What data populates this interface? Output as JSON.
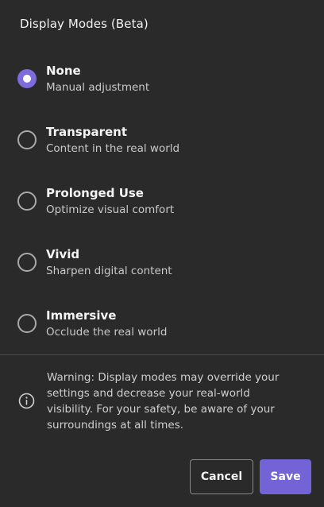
{
  "dialog": {
    "title": "Display Modes (Beta)"
  },
  "options": [
    {
      "label": "None",
      "description": "Manual adjustment",
      "selected": true
    },
    {
      "label": "Transparent",
      "description": "Content in the real world",
      "selected": false
    },
    {
      "label": "Prolonged Use",
      "description": "Optimize visual comfort",
      "selected": false
    },
    {
      "label": "Vivid",
      "description": "Sharpen digital content",
      "selected": false
    },
    {
      "label": "Immersive",
      "description": "Occlude the real world",
      "selected": false
    }
  ],
  "warning": {
    "icon": "info-icon",
    "text": "Warning: Display modes may override your settings and decrease your real-world visibility. For your safety, be aware of your surroundings at all times."
  },
  "buttons": {
    "cancel_label": "Cancel",
    "save_label": "Save"
  },
  "colors": {
    "background": "#2a2a2b",
    "accent": "#7463d6",
    "radio_selected": "#7e6bdc"
  }
}
